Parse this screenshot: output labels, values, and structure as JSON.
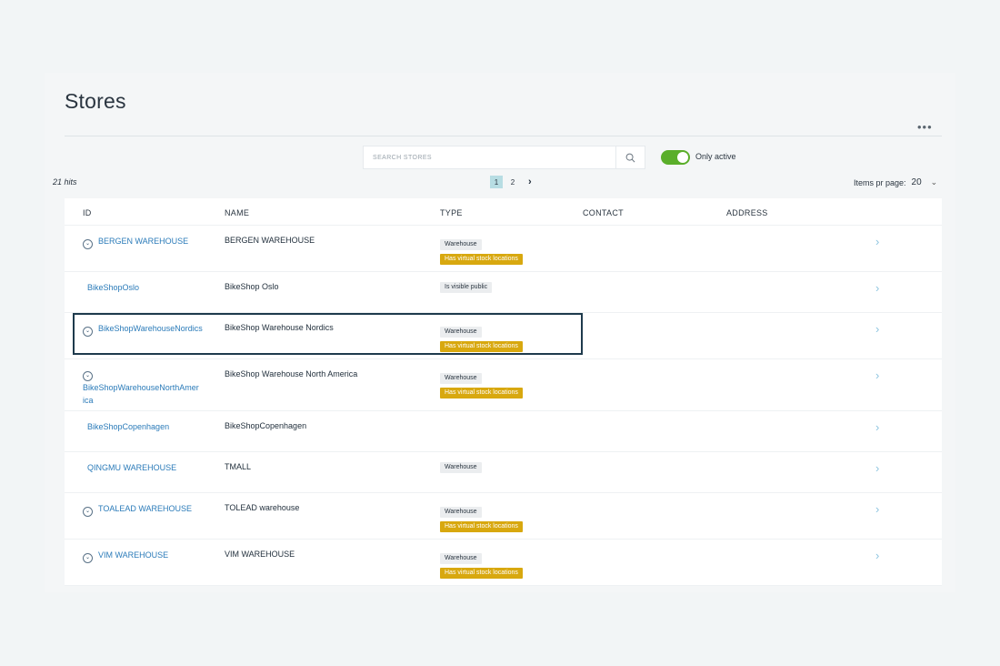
{
  "page": {
    "title": "Stores",
    "more_label": "•••"
  },
  "search": {
    "placeholder": "SEARCH STORES"
  },
  "filter": {
    "only_active_label": "Only active",
    "only_active": true
  },
  "results": {
    "hits_label": "21 hits"
  },
  "pagination": {
    "pages": [
      "1",
      "2"
    ],
    "current": "1",
    "next_label": "›"
  },
  "items_per_page": {
    "label": "Items pr page:",
    "value": "20"
  },
  "table": {
    "columns": {
      "id": "ID",
      "name": "NAME",
      "type": "TYPE",
      "contact": "CONTACT",
      "address": "ADDRESS"
    },
    "rows": [
      {
        "id": "BERGEN WAREHOUSE",
        "name": "BERGEN WAREHOUSE",
        "expandable": true,
        "badges": [
          "Warehouse",
          "Has virtual stock locations"
        ]
      },
      {
        "id": "BikeShopOslo",
        "name": "BikeShop Oslo",
        "expandable": false,
        "badges": [
          "Is visible public"
        ]
      },
      {
        "id": "BikeShopWarehouseNordics",
        "name": "BikeShop Warehouse Nordics",
        "expandable": true,
        "badges": [
          "Warehouse",
          "Has virtual stock locations"
        ]
      },
      {
        "id_lines": [
          "BikeShopWarehouseNorthAmer",
          "ica"
        ],
        "name": "BikeShop Warehouse North America",
        "expandable": true,
        "badges": [
          "Warehouse",
          "Has virtual stock locations"
        ]
      },
      {
        "id": "BikeShopCopenhagen",
        "name": "BikeShopCopenhagen",
        "expandable": false,
        "badges": []
      },
      {
        "id": "QINGMU WAREHOUSE",
        "name": "TMALL",
        "expandable": false,
        "badges": [
          "Warehouse"
        ]
      },
      {
        "id": "TOALEAD WAREHOUSE",
        "name": "TOLEAD warehouse",
        "expandable": true,
        "badges": [
          "Warehouse",
          "Has virtual stock locations"
        ]
      },
      {
        "id": "VIM WAREHOUSE",
        "name": "VIM WAREHOUSE",
        "expandable": true,
        "badges": [
          "Warehouse",
          "Has virtual stock locations"
        ]
      }
    ]
  },
  "icons": {
    "search": "search-icon",
    "expand": "chevron-down-icon",
    "row_open": "chevron-right-icon"
  },
  "colors": {
    "link": "#2b7bb9",
    "badge_gold": "#d8a80f",
    "toggle_on": "#5aae2a",
    "focus": "#1e3a4c"
  }
}
